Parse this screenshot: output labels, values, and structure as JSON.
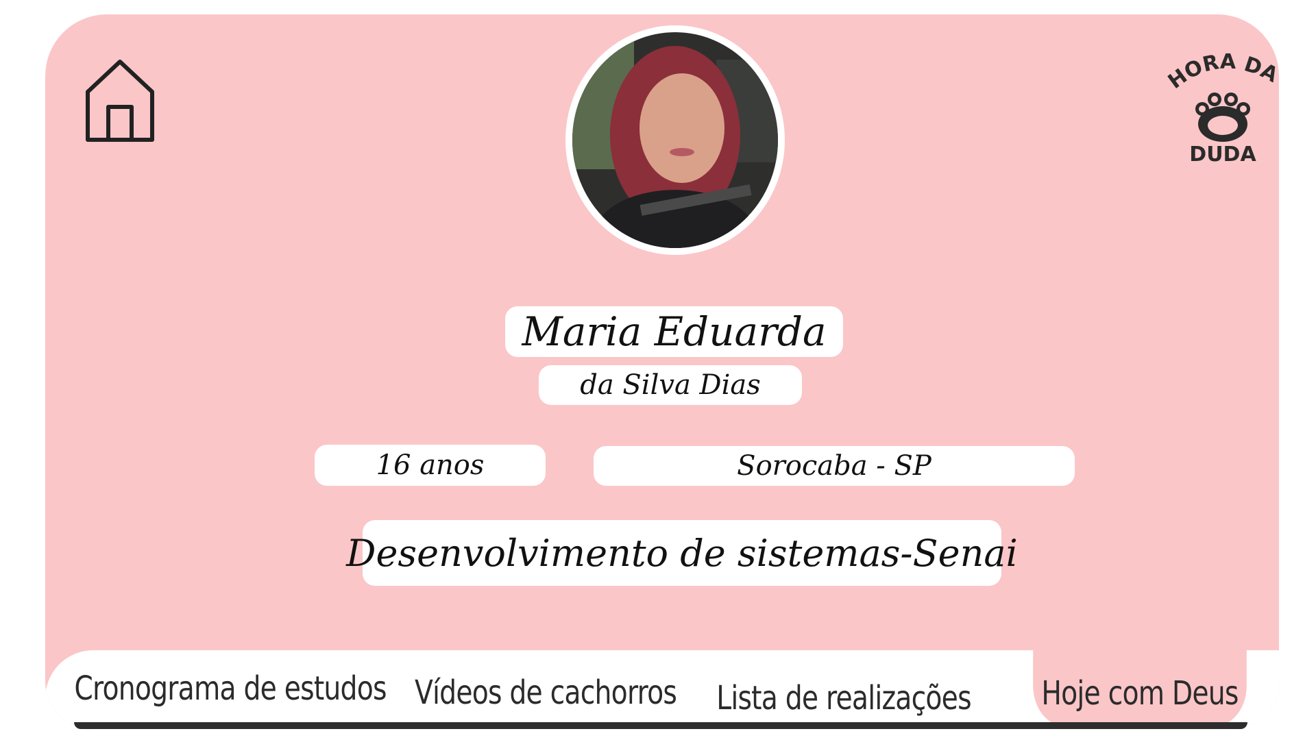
{
  "profile": {
    "first_name": "Maria Eduarda",
    "last_name": "da Silva Dias",
    "age": "16 anos",
    "city": "Sorocaba - SP",
    "course": "Desenvolvimento de sistemas-Senai"
  },
  "logo": {
    "line1": "HORA DA",
    "line2": "DUDA",
    "icon": "paw-icon"
  },
  "nav": {
    "home_icon": "home-icon",
    "tabs": [
      {
        "label": "Cronograma de estudos"
      },
      {
        "label": "Vídeos de cachorros"
      },
      {
        "label": "Lista de realizações"
      },
      {
        "label": "Hoje com Deus"
      }
    ],
    "active_tab": 3
  },
  "colors": {
    "background": "#fbc6c8",
    "pill": "#ffffff",
    "text": "#111111"
  }
}
